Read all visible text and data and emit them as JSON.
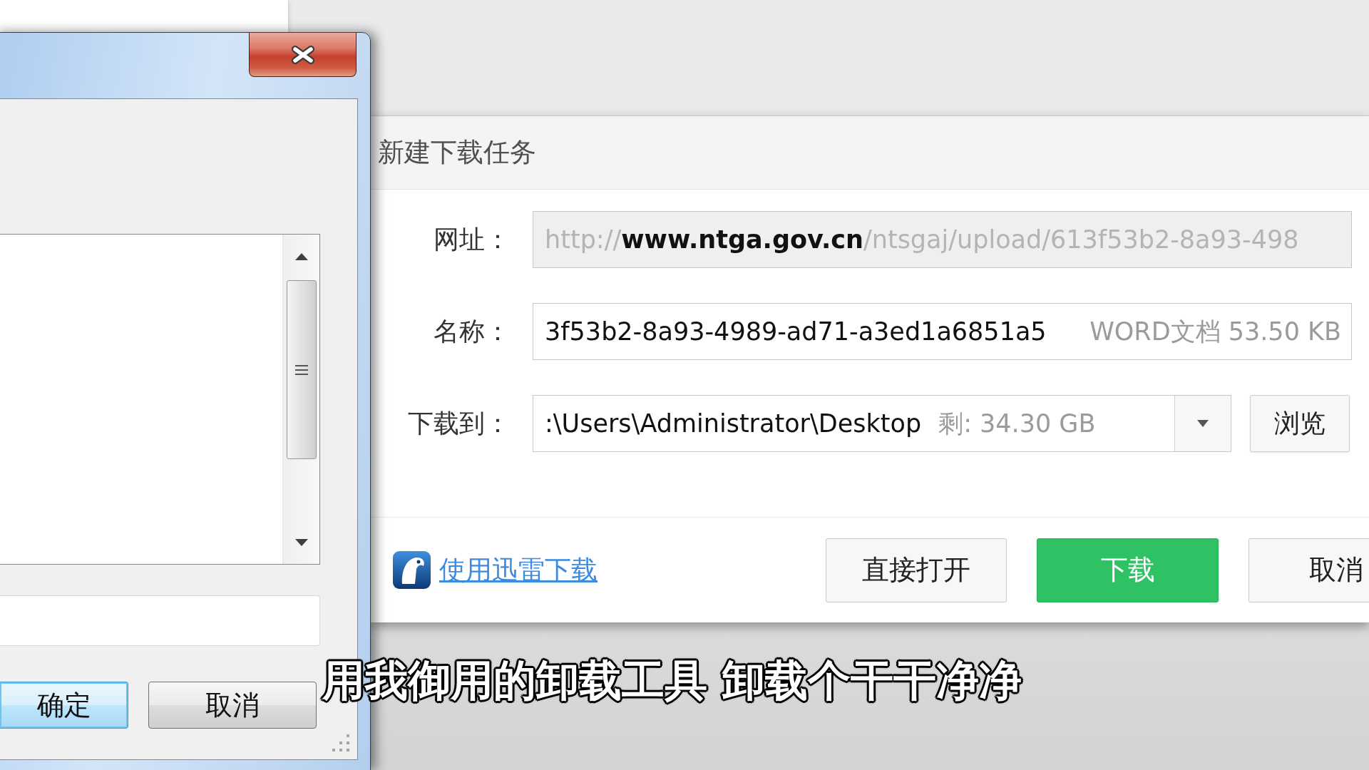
{
  "back_dialog": {
    "buttons": [
      {
        "label": "确定",
        "focused": true
      },
      {
        "label": "取消",
        "focused": false
      }
    ]
  },
  "download_dialog": {
    "title": "新建下载任务",
    "fields": [
      {
        "kind": "url",
        "label": "网址：",
        "value": "http://**www.ntga.gov.cn**/ntsgaj/upload/613f53b2-8a93-498",
        "disabled": true
      },
      {
        "kind": "name",
        "label": "名称：",
        "value": "3f53b2-8a93-4989-ad71-a3ed1a6851a5",
        "info": "WORD文档 53.50 KB",
        "disabled": false
      },
      {
        "kind": "folder",
        "label": "下载到：",
        "value": ":\\Users\\Administrator\\Desktop",
        "info": "剩: 34.30 GB",
        "button": "浏览",
        "disabled": false
      }
    ],
    "link": "使用迅雷下载",
    "buttons": [
      {
        "label": "直接打开",
        "primary": false
      },
      {
        "label": "下载",
        "primary": true
      },
      {
        "label": "取消",
        "primary": false
      }
    ]
  },
  "subtitle": "用我御用的卸载工具 卸载个干干净净"
}
